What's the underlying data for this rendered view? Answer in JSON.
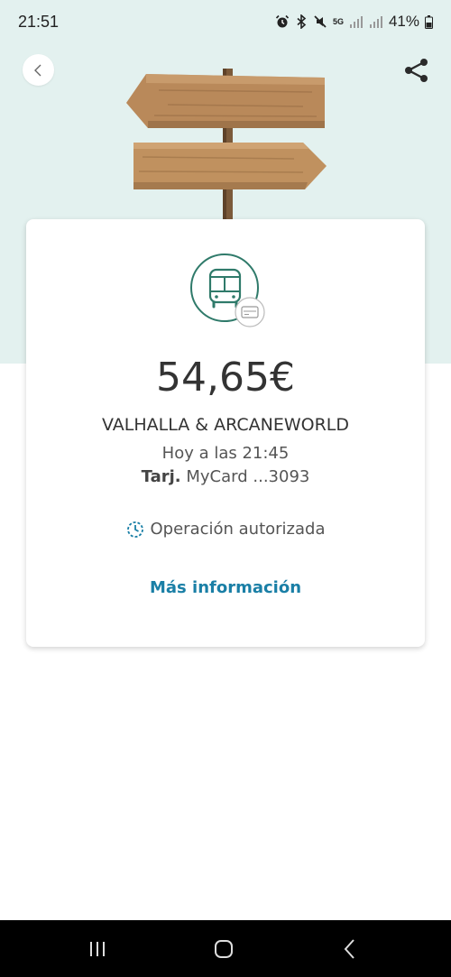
{
  "status_bar": {
    "time": "21:51",
    "network": "5G",
    "battery": "41%"
  },
  "header": {
    "back_icon": "chevron-left-icon",
    "share_icon": "share-icon",
    "hero_image": "wooden-signpost"
  },
  "transaction": {
    "category_icon": "bus-icon",
    "payment_icon": "card-icon",
    "amount": "54,65€",
    "merchant": "VALHALLA & ARCANEWORLD",
    "datetime": "Hoy a las 21:45",
    "card_prefix": "Tarj.",
    "card_name": "MyCard ...3093",
    "status_icon": "clock-icon",
    "status": "Operación autorizada",
    "more_info": "Más información"
  },
  "colors": {
    "hero_bg": "#e3f1ef",
    "icon_green": "#2f7a6a",
    "link_blue": "#1a7fa6",
    "status_blue": "#1a7fa6"
  },
  "nav": {
    "recents_icon": "recents-icon",
    "home_icon": "home-icon",
    "back_icon": "back-icon"
  }
}
